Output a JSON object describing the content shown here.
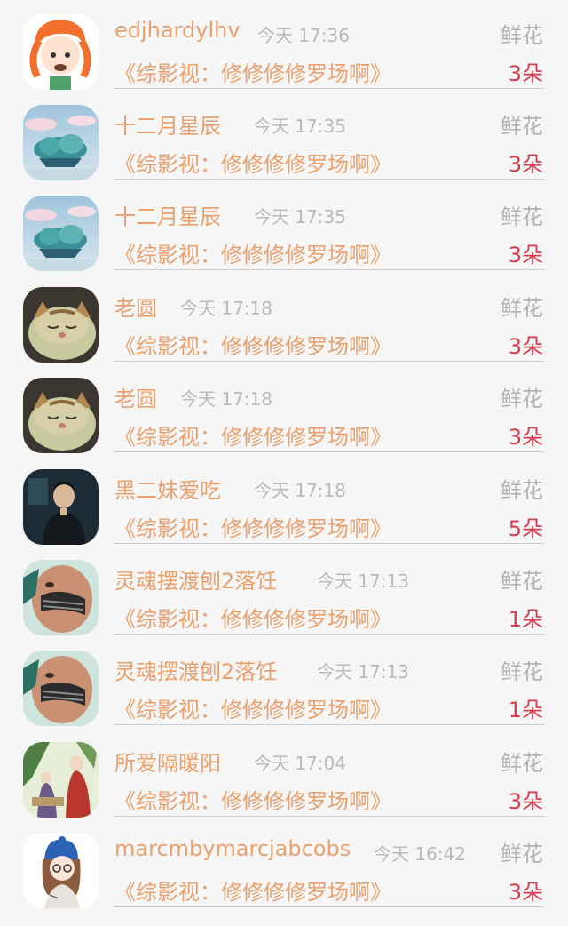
{
  "gift_records": [
    {
      "user": "edjhardylhv",
      "time": "今天 17:36",
      "gift": "鲜花",
      "book": "《综影视：修修修修罗场啊》",
      "count": "3朵",
      "avatar": "cartoon-girl-avatar"
    },
    {
      "user": "十二月星辰",
      "time": "今天 17:35",
      "gift": "鲜花",
      "book": "《综影视：修修修修罗场啊》",
      "count": "3朵",
      "avatar": "island-clouds-avatar"
    },
    {
      "user": "十二月星辰",
      "time": "今天 17:35",
      "gift": "鲜花",
      "book": "《综影视：修修修修罗场啊》",
      "count": "3朵",
      "avatar": "island-clouds-avatar"
    },
    {
      "user": "老圆",
      "time": "今天 17:18",
      "gift": "鲜花",
      "book": "《综影视：修修修修罗场啊》",
      "count": "3朵",
      "avatar": "sleeping-cat-avatar"
    },
    {
      "user": "老圆",
      "time": "今天 17:18",
      "gift": "鲜花",
      "book": "《综影视：修修修修罗场啊》",
      "count": "3朵",
      "avatar": "sleeping-cat-avatar"
    },
    {
      "user": "黑二妹爱吃",
      "time": "今天 17:18",
      "gift": "鲜花",
      "book": "《综影视：修修修修罗场啊》",
      "count": "5朵",
      "avatar": "man-portrait-avatar"
    },
    {
      "user": "灵魂摆渡刨2落饪",
      "time": "今天 17:13",
      "gift": "鲜花",
      "book": "《综影视：修修修修罗场啊》",
      "count": "1朵",
      "avatar": "face-art-avatar"
    },
    {
      "user": "灵魂摆渡刨2落饪",
      "time": "今天 17:13",
      "gift": "鲜花",
      "book": "《综影视：修修修修罗场啊》",
      "count": "1朵",
      "avatar": "face-art-avatar"
    },
    {
      "user": "所爱隔暖阳",
      "time": "今天 17:04",
      "gift": "鲜花",
      "book": "《综影视：修修修修罗场啊》",
      "count": "3朵",
      "avatar": "ancient-illustration-avatar"
    },
    {
      "user": "marcmbymarcjabcobs",
      "time": "今天 16:42",
      "gift": "鲜花",
      "book": "《综影视：修修修修罗场啊》",
      "count": "3朵",
      "avatar": "blue-hat-girl-avatar"
    }
  ],
  "colors": {
    "username": "#e9a06d",
    "book_title": "#e9a06d",
    "time": "#b9b9b9",
    "gift_type": "#b3b3b3",
    "count": "#d63c4d",
    "background": "#f7f6f6"
  }
}
